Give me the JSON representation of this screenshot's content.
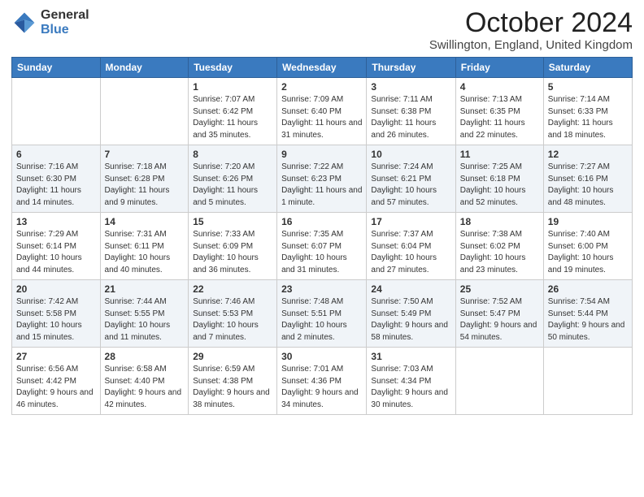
{
  "logo": {
    "general": "General",
    "blue": "Blue"
  },
  "header": {
    "month": "October 2024",
    "location": "Swillington, England, United Kingdom"
  },
  "weekdays": [
    "Sunday",
    "Monday",
    "Tuesday",
    "Wednesday",
    "Thursday",
    "Friday",
    "Saturday"
  ],
  "weeks": [
    [
      {
        "day": "",
        "info": ""
      },
      {
        "day": "",
        "info": ""
      },
      {
        "day": "1",
        "info": "Sunrise: 7:07 AM\nSunset: 6:42 PM\nDaylight: 11 hours and 35 minutes."
      },
      {
        "day": "2",
        "info": "Sunrise: 7:09 AM\nSunset: 6:40 PM\nDaylight: 11 hours and 31 minutes."
      },
      {
        "day": "3",
        "info": "Sunrise: 7:11 AM\nSunset: 6:38 PM\nDaylight: 11 hours and 26 minutes."
      },
      {
        "day": "4",
        "info": "Sunrise: 7:13 AM\nSunset: 6:35 PM\nDaylight: 11 hours and 22 minutes."
      },
      {
        "day": "5",
        "info": "Sunrise: 7:14 AM\nSunset: 6:33 PM\nDaylight: 11 hours and 18 minutes."
      }
    ],
    [
      {
        "day": "6",
        "info": "Sunrise: 7:16 AM\nSunset: 6:30 PM\nDaylight: 11 hours and 14 minutes."
      },
      {
        "day": "7",
        "info": "Sunrise: 7:18 AM\nSunset: 6:28 PM\nDaylight: 11 hours and 9 minutes."
      },
      {
        "day": "8",
        "info": "Sunrise: 7:20 AM\nSunset: 6:26 PM\nDaylight: 11 hours and 5 minutes."
      },
      {
        "day": "9",
        "info": "Sunrise: 7:22 AM\nSunset: 6:23 PM\nDaylight: 11 hours and 1 minute."
      },
      {
        "day": "10",
        "info": "Sunrise: 7:24 AM\nSunset: 6:21 PM\nDaylight: 10 hours and 57 minutes."
      },
      {
        "day": "11",
        "info": "Sunrise: 7:25 AM\nSunset: 6:18 PM\nDaylight: 10 hours and 52 minutes."
      },
      {
        "day": "12",
        "info": "Sunrise: 7:27 AM\nSunset: 6:16 PM\nDaylight: 10 hours and 48 minutes."
      }
    ],
    [
      {
        "day": "13",
        "info": "Sunrise: 7:29 AM\nSunset: 6:14 PM\nDaylight: 10 hours and 44 minutes."
      },
      {
        "day": "14",
        "info": "Sunrise: 7:31 AM\nSunset: 6:11 PM\nDaylight: 10 hours and 40 minutes."
      },
      {
        "day": "15",
        "info": "Sunrise: 7:33 AM\nSunset: 6:09 PM\nDaylight: 10 hours and 36 minutes."
      },
      {
        "day": "16",
        "info": "Sunrise: 7:35 AM\nSunset: 6:07 PM\nDaylight: 10 hours and 31 minutes."
      },
      {
        "day": "17",
        "info": "Sunrise: 7:37 AM\nSunset: 6:04 PM\nDaylight: 10 hours and 27 minutes."
      },
      {
        "day": "18",
        "info": "Sunrise: 7:38 AM\nSunset: 6:02 PM\nDaylight: 10 hours and 23 minutes."
      },
      {
        "day": "19",
        "info": "Sunrise: 7:40 AM\nSunset: 6:00 PM\nDaylight: 10 hours and 19 minutes."
      }
    ],
    [
      {
        "day": "20",
        "info": "Sunrise: 7:42 AM\nSunset: 5:58 PM\nDaylight: 10 hours and 15 minutes."
      },
      {
        "day": "21",
        "info": "Sunrise: 7:44 AM\nSunset: 5:55 PM\nDaylight: 10 hours and 11 minutes."
      },
      {
        "day": "22",
        "info": "Sunrise: 7:46 AM\nSunset: 5:53 PM\nDaylight: 10 hours and 7 minutes."
      },
      {
        "day": "23",
        "info": "Sunrise: 7:48 AM\nSunset: 5:51 PM\nDaylight: 10 hours and 2 minutes."
      },
      {
        "day": "24",
        "info": "Sunrise: 7:50 AM\nSunset: 5:49 PM\nDaylight: 9 hours and 58 minutes."
      },
      {
        "day": "25",
        "info": "Sunrise: 7:52 AM\nSunset: 5:47 PM\nDaylight: 9 hours and 54 minutes."
      },
      {
        "day": "26",
        "info": "Sunrise: 7:54 AM\nSunset: 5:44 PM\nDaylight: 9 hours and 50 minutes."
      }
    ],
    [
      {
        "day": "27",
        "info": "Sunrise: 6:56 AM\nSunset: 4:42 PM\nDaylight: 9 hours and 46 minutes."
      },
      {
        "day": "28",
        "info": "Sunrise: 6:58 AM\nSunset: 4:40 PM\nDaylight: 9 hours and 42 minutes."
      },
      {
        "day": "29",
        "info": "Sunrise: 6:59 AM\nSunset: 4:38 PM\nDaylight: 9 hours and 38 minutes."
      },
      {
        "day": "30",
        "info": "Sunrise: 7:01 AM\nSunset: 4:36 PM\nDaylight: 9 hours and 34 minutes."
      },
      {
        "day": "31",
        "info": "Sunrise: 7:03 AM\nSunset: 4:34 PM\nDaylight: 9 hours and 30 minutes."
      },
      {
        "day": "",
        "info": ""
      },
      {
        "day": "",
        "info": ""
      }
    ]
  ]
}
